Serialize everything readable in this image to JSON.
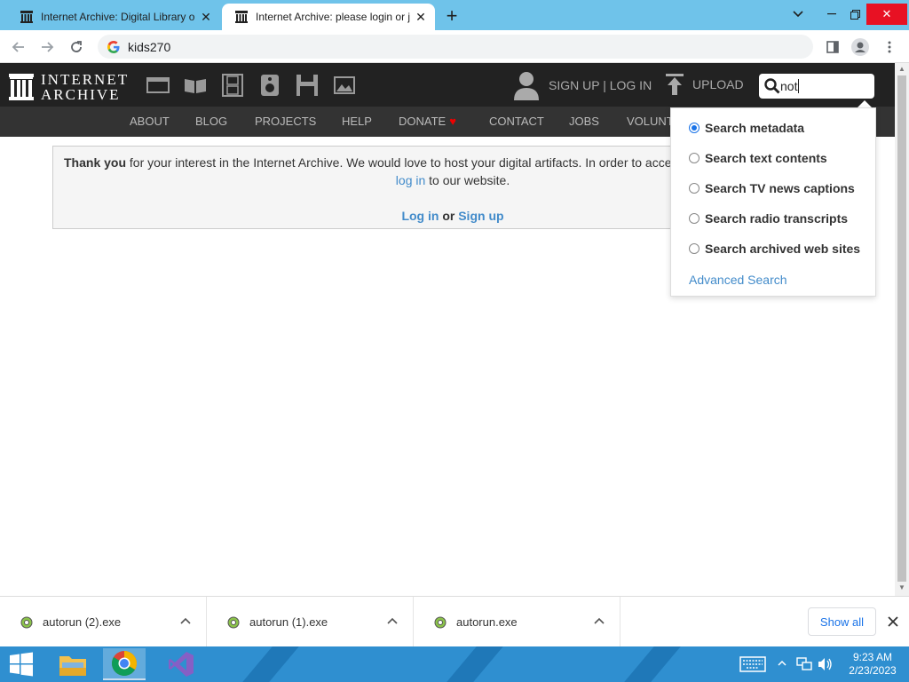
{
  "browser": {
    "tabs": [
      {
        "title": "Internet Archive: Digital Library o",
        "active": false
      },
      {
        "title": "Internet Archive: please login or j",
        "active": true
      }
    ],
    "new_tab": "+",
    "address": "kids270"
  },
  "ia": {
    "logo_line1": "INTERNET",
    "logo_line2": "ARCHIVE",
    "signup_login": "SIGN UP | LOG IN",
    "upload": "UPLOAD",
    "search_value": "not",
    "nav": [
      "ABOUT",
      "BLOG",
      "PROJECTS",
      "HELP",
      "DONATE",
      "CONTACT",
      "JOBS",
      "VOLUNT"
    ]
  },
  "notice": {
    "bold_prefix": "Thank you",
    "text1": " for your interest in the Internet Archive. We would love to host your digital artifacts. In order to acce",
    "link_login": "log in",
    "text2": " to our website.",
    "login_link": "Log in",
    "or": "or",
    "signup_link": "Sign up"
  },
  "search_dropdown": {
    "options": [
      {
        "label": "Search metadata",
        "selected": true
      },
      {
        "label": "Search text contents",
        "selected": false
      },
      {
        "label": "Search TV news captions",
        "selected": false
      },
      {
        "label": "Search radio transcripts",
        "selected": false
      },
      {
        "label": "Search archived web sites",
        "selected": false
      }
    ],
    "advanced": "Advanced Search"
  },
  "downloads": {
    "items": [
      "autorun (2).exe",
      "autorun (1).exe",
      "autorun.exe"
    ],
    "show_all": "Show all"
  },
  "taskbar": {
    "time": "9:23 AM",
    "date": "2/23/2023"
  },
  "colors": {
    "tabstrip": "#6fc3ea",
    "ia_header": "#222222",
    "ia_subnav": "#333333",
    "link": "#428bca",
    "taskbar": "#2f8fd0"
  }
}
